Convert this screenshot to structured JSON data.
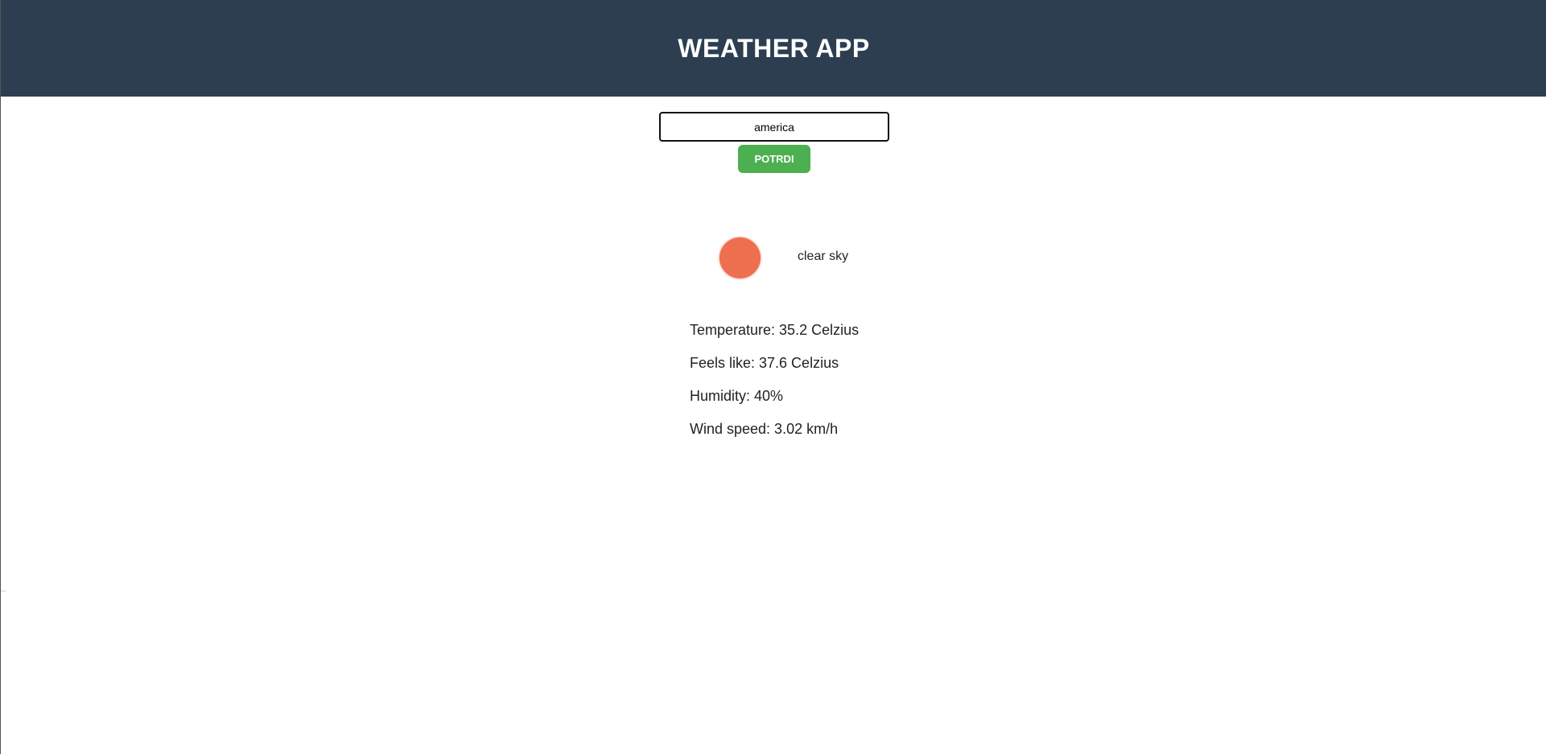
{
  "header": {
    "title": "WEATHER APP"
  },
  "search": {
    "value": "america",
    "button_label": "POTRDI"
  },
  "weather": {
    "icon": "sun-icon",
    "icon_color": "#ed6f4f",
    "description": "clear sky"
  },
  "details": {
    "temperature": "Temperature: 35.2 Celzius",
    "feels_like": "Feels like: 37.6 Celzius",
    "humidity": "Humidity: 40%",
    "wind_speed": "Wind speed: 3.02 km/h"
  },
  "colors": {
    "header_bg": "#2c3e50",
    "button_bg": "#4caf50"
  }
}
